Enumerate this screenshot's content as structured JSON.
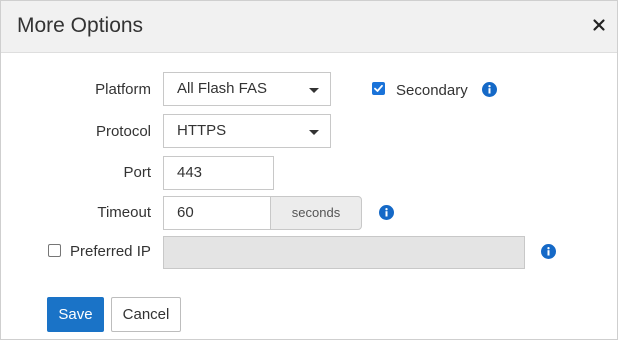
{
  "dialog": {
    "title": "More Options",
    "close_icon": "close-icon"
  },
  "form": {
    "platform": {
      "label": "Platform",
      "selected": "All Flash FAS"
    },
    "secondary": {
      "label": "Secondary",
      "checked": true
    },
    "protocol": {
      "label": "Protocol",
      "selected": "HTTPS"
    },
    "port": {
      "label": "Port",
      "value": "443"
    },
    "timeout": {
      "label": "Timeout",
      "value": "60",
      "unit": "seconds"
    },
    "preferred_ip": {
      "label": "Preferred IP",
      "checked": false,
      "value": ""
    }
  },
  "buttons": {
    "save": "Save",
    "cancel": "Cancel"
  },
  "colors": {
    "accent": "#1a73c7",
    "info_icon": "#1569c7",
    "header_bg": "#f1f1f1"
  }
}
